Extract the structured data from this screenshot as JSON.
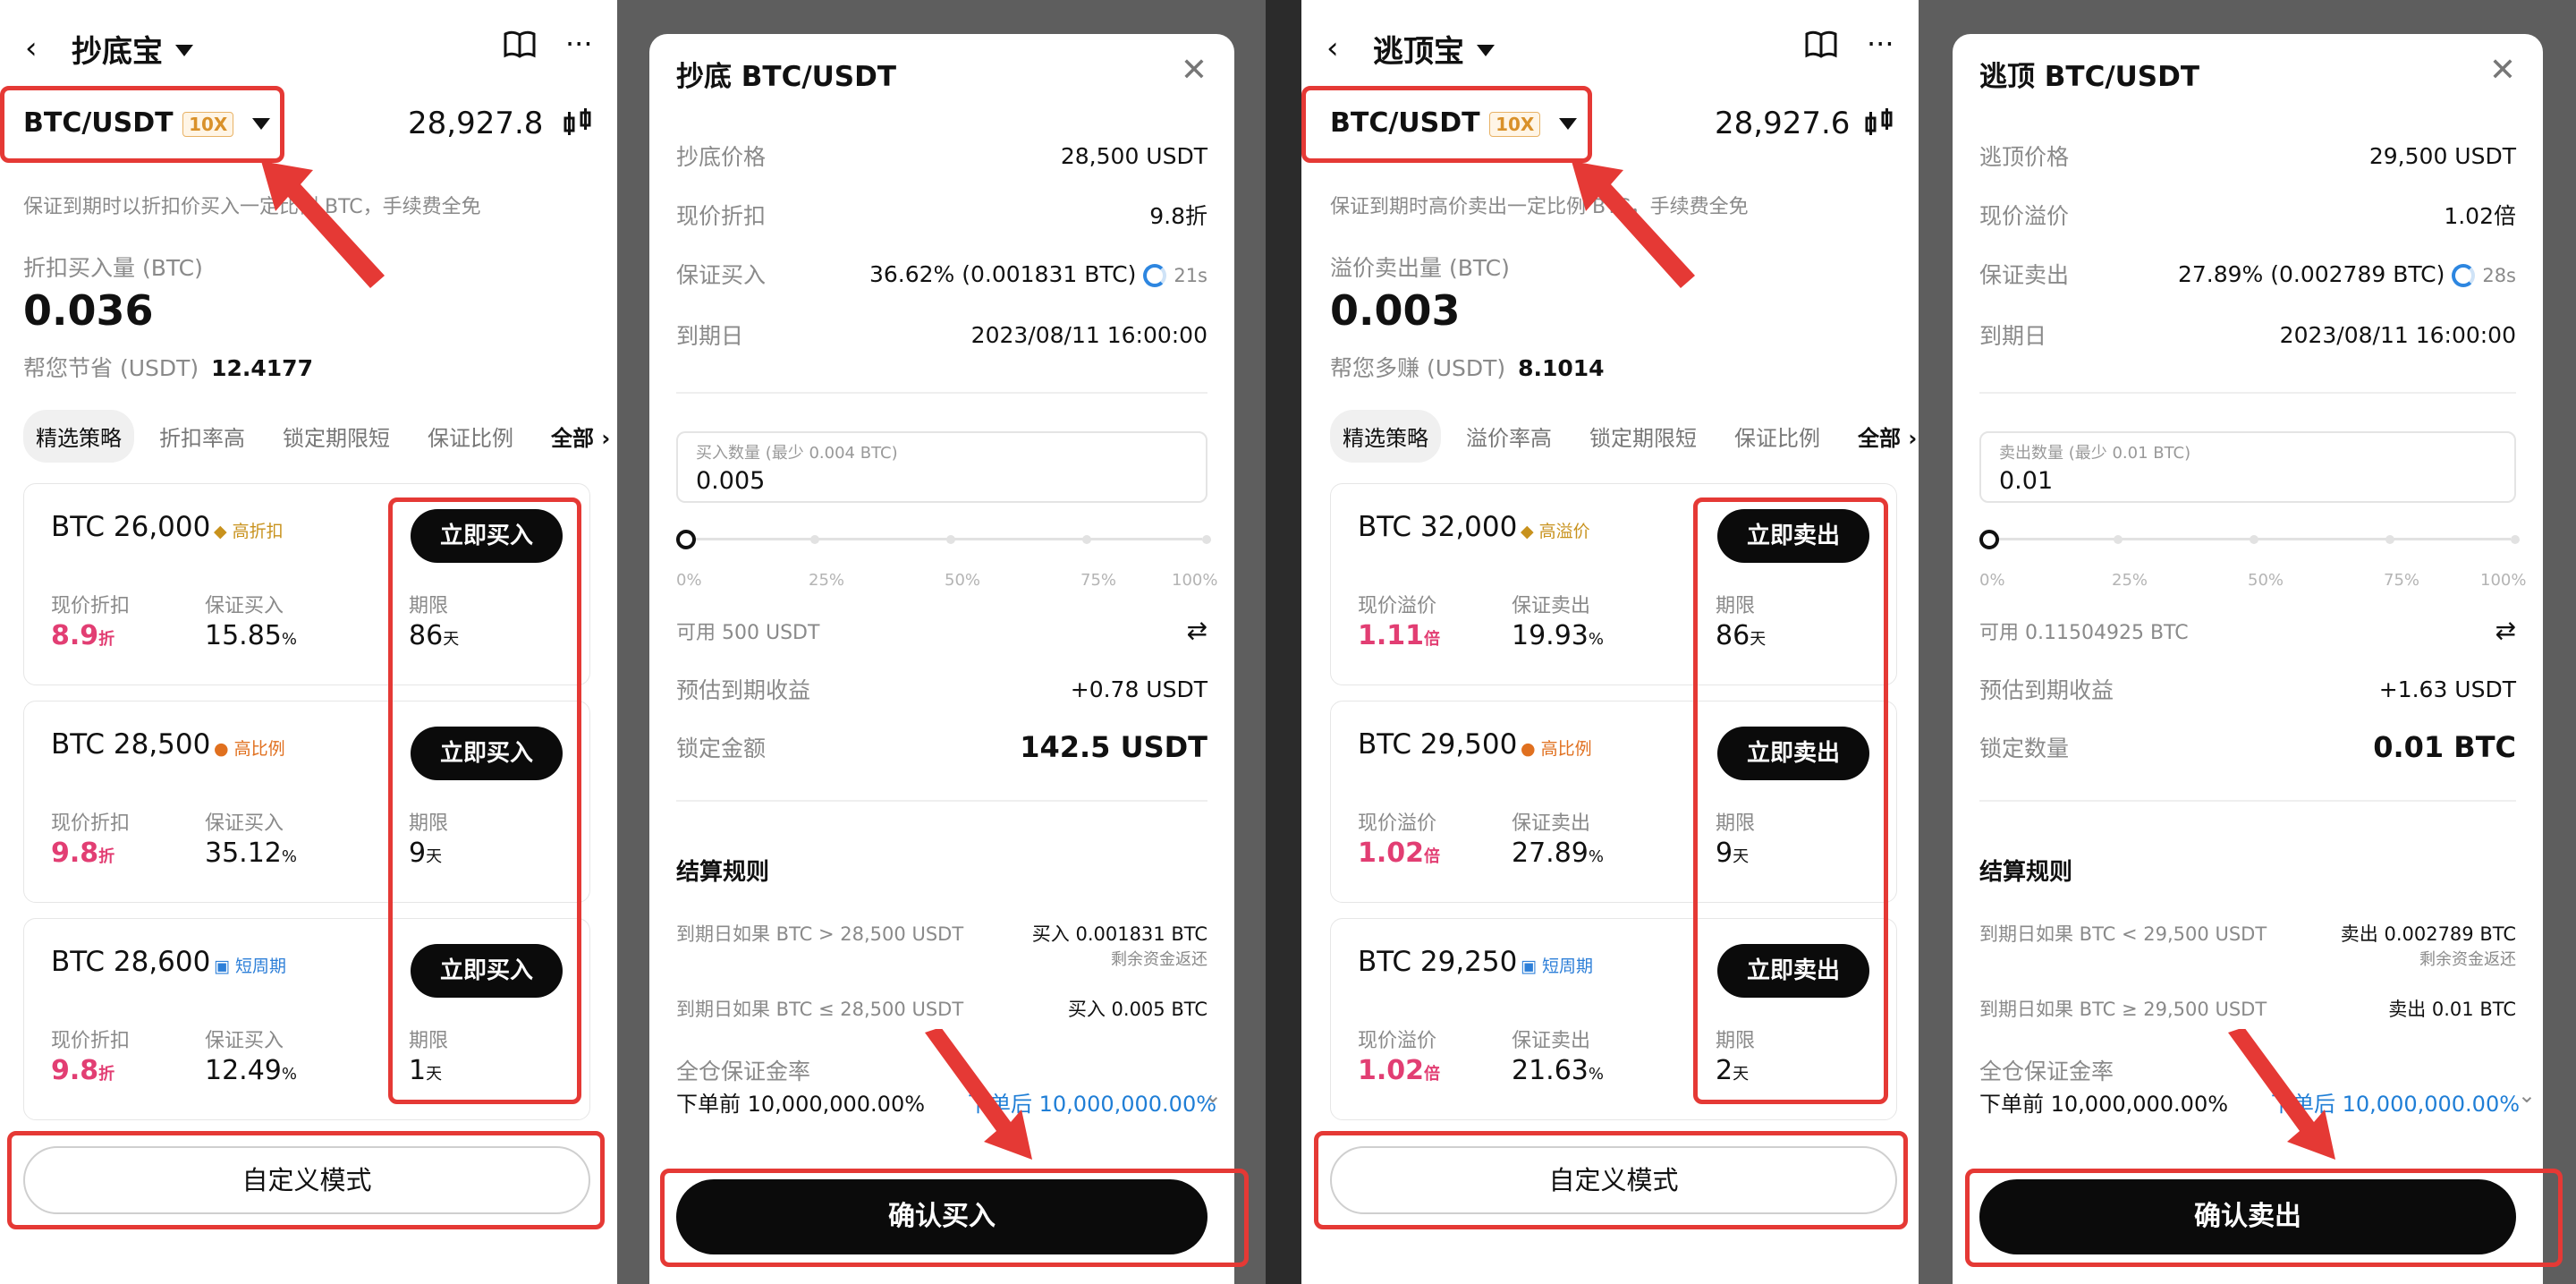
{
  "panel1": {
    "header_title": "抄底宝",
    "pair": "BTC/USDT",
    "leverage": "10X",
    "price": "28,927.8",
    "desc": "保证到期时以折扣价买入一定比例 BTC，手续费全免",
    "amount_label": "折扣买入量 (BTC)",
    "amount_value": "0.036",
    "save_label": "帮您节省 (USDT)",
    "save_value": "12.4177",
    "tabs": [
      "精选策略",
      "折扣率高",
      "锁定期限短",
      "保证比例",
      "全部"
    ],
    "cards": [
      {
        "name": "BTC 26,000",
        "badge": "高折扣",
        "l1": "现价折扣",
        "v1": "8.9",
        "u1": "折",
        "l2": "保证买入",
        "v2": "15.85",
        "u2": "%",
        "l3": "期限",
        "v3": "86",
        "u3": "天",
        "btn": "立即买入"
      },
      {
        "name": "BTC 28,500",
        "badge": "高比例",
        "l1": "现价折扣",
        "v1": "9.8",
        "u1": "折",
        "l2": "保证买入",
        "v2": "35.12",
        "u2": "%",
        "l3": "期限",
        "v3": "9",
        "u3": "天",
        "btn": "立即买入"
      },
      {
        "name": "BTC 28,600",
        "badge": "短周期",
        "l1": "现价折扣",
        "v1": "9.8",
        "u1": "折",
        "l2": "保证买入",
        "v2": "12.49",
        "u2": "%",
        "l3": "期限",
        "v3": "1",
        "u3": "天",
        "btn": "立即买入"
      }
    ],
    "custom_btn": "自定义模式"
  },
  "panel2": {
    "title": "抄底 BTC/USDT",
    "r1k": "抄底价格",
    "r1v": "28,500 USDT",
    "r2k": "现价折扣",
    "r2v": "9.8折",
    "r3k": "保证买入",
    "r3v": "36.62% (0.001831 BTC)",
    "r3t": "21s",
    "r4k": "到期日",
    "r4v": "2023/08/11 16:00:00",
    "input_ph": "买入数量 (最少 0.004 BTC)",
    "input_val": "0.005",
    "pcts": [
      "0%",
      "25%",
      "50%",
      "75%",
      "100%"
    ],
    "avail": "可用  500 USDT",
    "est_k": "预估到期收益",
    "est_v": "+0.78 USDT",
    "lock_k": "锁定金额",
    "lock_v": "142.5 USDT",
    "rules_title": "结算规则",
    "rule1k": "到期日如果 BTC > 28,500 USDT",
    "rule1v": "买入 0.001831 BTC",
    "rule1s": "剩余资金返还",
    "rule2k": "到期日如果 BTC ≤ 28,500 USDT",
    "rule2v": "买入 0.005 BTC",
    "margin_label": "全仓保证金率",
    "before": "下单前 10,000,000.00%",
    "after": "下单后 10,000,000.00%",
    "confirm": "确认买入"
  },
  "panel3": {
    "header_title": "逃顶宝",
    "pair": "BTC/USDT",
    "leverage": "10X",
    "price": "28,927.6",
    "desc": "保证到期时高价卖出一定比例 BTC，手续费全免",
    "amount_label": "溢价卖出量 (BTC)",
    "amount_value": "0.003",
    "save_label": "帮您多赚 (USDT)",
    "save_value": "8.1014",
    "tabs": [
      "精选策略",
      "溢价率高",
      "锁定期限短",
      "保证比例",
      "全部"
    ],
    "cards": [
      {
        "name": "BTC 32,000",
        "badge": "高溢价",
        "l1": "现价溢价",
        "v1": "1.11",
        "u1": "倍",
        "l2": "保证卖出",
        "v2": "19.93",
        "u2": "%",
        "l3": "期限",
        "v3": "86",
        "u3": "天",
        "btn": "立即卖出"
      },
      {
        "name": "BTC 29,500",
        "badge": "高比例",
        "l1": "现价溢价",
        "v1": "1.02",
        "u1": "倍",
        "l2": "保证卖出",
        "v2": "27.89",
        "u2": "%",
        "l3": "期限",
        "v3": "9",
        "u3": "天",
        "btn": "立即卖出"
      },
      {
        "name": "BTC 29,250",
        "badge": "短周期",
        "l1": "现价溢价",
        "v1": "1.02",
        "u1": "倍",
        "l2": "保证卖出",
        "v2": "21.63",
        "u2": "%",
        "l3": "期限",
        "v3": "2",
        "u3": "天",
        "btn": "立即卖出"
      }
    ],
    "custom_btn": "自定义模式"
  },
  "panel4": {
    "title": "逃顶 BTC/USDT",
    "r1k": "逃顶价格",
    "r1v": "29,500 USDT",
    "r2k": "现价溢价",
    "r2v": "1.02倍",
    "r3k": "保证卖出",
    "r3v": "27.89% (0.002789 BTC)",
    "r3t": "28s",
    "r4k": "到期日",
    "r4v": "2023/08/11 16:00:00",
    "input_ph": "卖出数量 (最少 0.01 BTC)",
    "input_val": "0.01",
    "pcts": [
      "0%",
      "25%",
      "50%",
      "75%",
      "100%"
    ],
    "avail": "可用  0.11504925 BTC",
    "est_k": "预估到期收益",
    "est_v": "+1.63 USDT",
    "lock_k": "锁定数量",
    "lock_v": "0.01 BTC",
    "rules_title": "结算规则",
    "rule1k": "到期日如果 BTC < 29,500 USDT",
    "rule1v": "卖出 0.002789 BTC",
    "rule1s": "剩余资金返还",
    "rule2k": "到期日如果 BTC ≥ 29,500 USDT",
    "rule2v": "卖出 0.01 BTC",
    "margin_label": "全仓保证金率",
    "before": "下单前 10,000,000.00%",
    "after": "下单后 10,000,000.00%",
    "confirm": "确认卖出"
  },
  "colors": {
    "accent_red": "#e53935",
    "pink": "#e23e73",
    "blue": "#1f7ed6",
    "black_btn": "#0b0b0b"
  }
}
